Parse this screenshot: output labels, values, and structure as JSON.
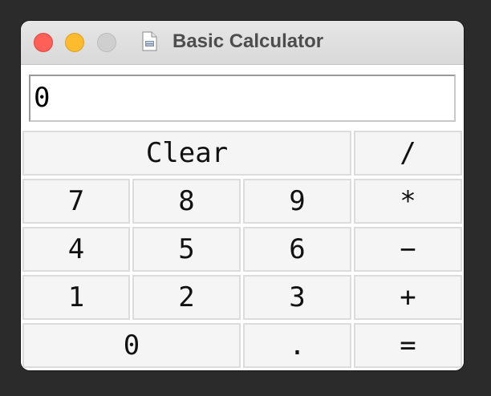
{
  "window": {
    "title": "Basic Calculator"
  },
  "display": {
    "value": "0"
  },
  "keys": {
    "clear": "Clear",
    "divide": "/",
    "seven": "7",
    "eight": "8",
    "nine": "9",
    "multiply": "*",
    "four": "4",
    "five": "5",
    "six": "6",
    "subtract": "−",
    "one": "1",
    "two": "2",
    "three": "3",
    "add": "+",
    "zero": "0",
    "decimal": ".",
    "equals": "="
  },
  "icons": {
    "close": "close-traffic-light",
    "minimize": "minimize-traffic-light",
    "zoom": "zoom-traffic-light",
    "document": "document-icon"
  },
  "colors": {
    "close": "#fe5f57",
    "minimize": "#febb2e",
    "zoom_disabled": "#cfcfcf",
    "button_face": "#f5f5f5",
    "button_border": "#dcdcdc"
  }
}
